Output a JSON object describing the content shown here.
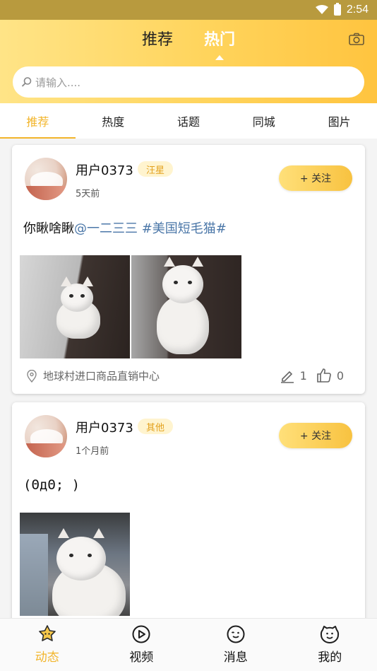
{
  "status_bar": {
    "time": "2:54"
  },
  "header": {
    "tabs": [
      {
        "label": "推荐",
        "active": false
      },
      {
        "label": "热门",
        "active": true
      }
    ],
    "camera_icon": "camera-icon"
  },
  "search": {
    "placeholder": "请输入...."
  },
  "category_tabs": [
    {
      "label": "推荐",
      "active": true
    },
    {
      "label": "热度",
      "active": false
    },
    {
      "label": "话题",
      "active": false
    },
    {
      "label": "同城",
      "active": false
    },
    {
      "label": "图片",
      "active": false
    }
  ],
  "posts": [
    {
      "username": "用户0373",
      "tag": "汪星",
      "time": "5天前",
      "follow_label": "+ 关注",
      "content_plain": "你瞅啥瞅",
      "content_mention": "@一二三三",
      "content_topic": " #美国短毛猫#",
      "location": "地球村进口商品直销中心",
      "comments": "1",
      "likes": "0"
    },
    {
      "username": "用户0373",
      "tag": "其他",
      "time": "1个月前",
      "follow_label": "+ 关注",
      "content_plain": "(ΘдΘ; )"
    }
  ],
  "bottom_nav": [
    {
      "label": "动态",
      "icon": "star-face-icon",
      "active": true
    },
    {
      "label": "视频",
      "icon": "play-circle-icon",
      "active": false
    },
    {
      "label": "消息",
      "icon": "chat-face-icon",
      "active": false
    },
    {
      "label": "我的",
      "icon": "smile-face-icon",
      "active": false
    }
  ],
  "colors": {
    "accent": "#f2b52b",
    "header_gradient_start": "#ffe487",
    "header_gradient_end": "#ffc43f",
    "link_blue": "#4b77a8",
    "tag_bg": "#fff4cf",
    "tag_text": "#e3a11d"
  }
}
